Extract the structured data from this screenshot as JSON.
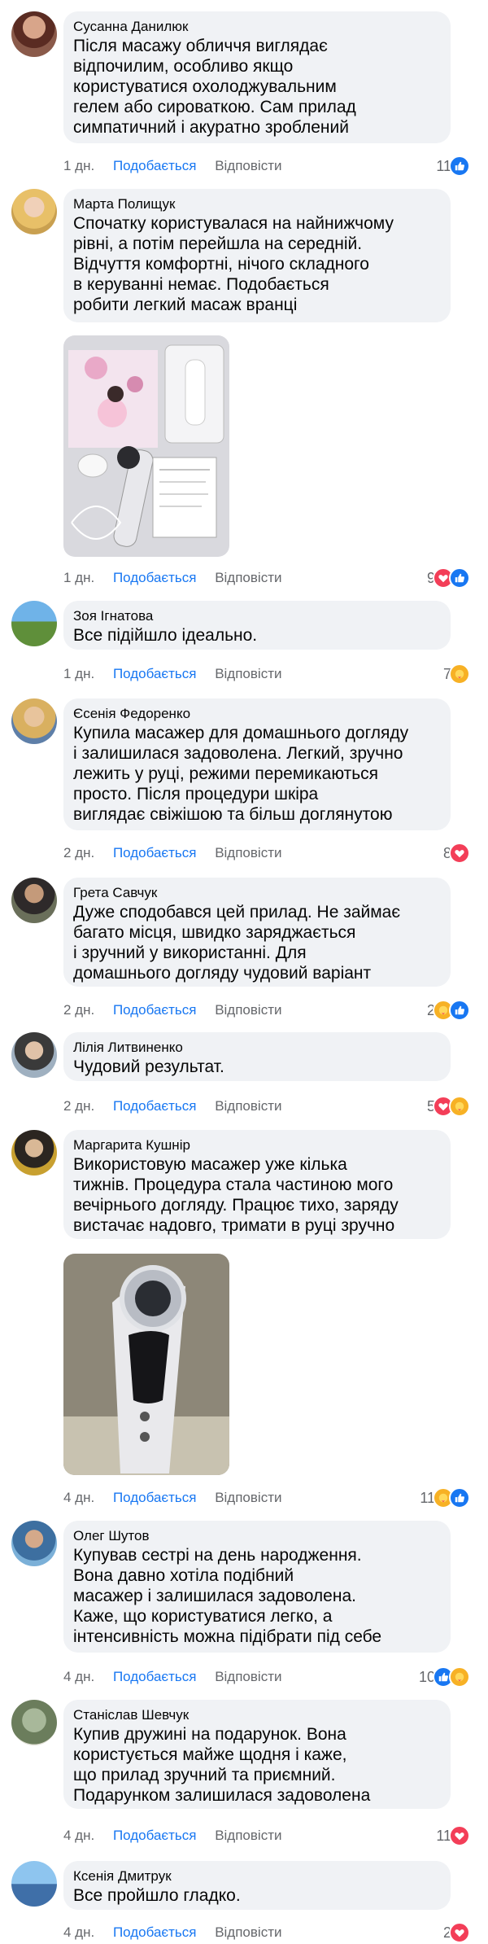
{
  "actions": {
    "like": "Подобається",
    "reply": "Відповісти"
  },
  "colors": {
    "like_blue": "#1877f2",
    "love_red": "#f33e58",
    "care_yellow": "#f7b125",
    "bubble": "#f0f2f5",
    "meta": "#65676b"
  },
  "comments": [
    {
      "author": "Сусанна Данилюк",
      "text": "Після масажу обличчя виглядає\nвідпочилим, особливо якщо\nкористуватися охолоджувальним\nгелем або сироваткою. Сам прилад\nсимпатичний і акуратно зроблений",
      "time": "1 дн.",
      "count": "11",
      "reactions": [
        "like-icon"
      ]
    },
    {
      "author": "Марта Полищук",
      "text": "Спочатку користувалася на найнижчому\nрівні, а потім перейшла на середній.\nВідчуття комфортні, нічого складного\nв керуванні немає. Подобається\nробити легкий масаж вранці",
      "time": "1 дн.",
      "count": "9",
      "reactions": [
        "love-icon",
        "like-icon"
      ],
      "photo": "device-box-photo"
    },
    {
      "author": "Зоя Ігнатова",
      "text": "Все підійшло ідеально.",
      "time": "1 дн.",
      "count": "7",
      "reactions": [
        "care-icon"
      ]
    },
    {
      "author": "Єсенія Федоренко",
      "text": "Купила масажер для домашнього догляду\nі залишилася задоволена. Легкий, зручно\nлежить у руці, режими перемикаються\nпросто. Після процедури шкіра\nвиглядає свіжішою та більш доглянутою",
      "time": "2 дн.",
      "count": "8",
      "reactions": [
        "love-icon"
      ]
    },
    {
      "author": "Грета Савчук",
      "text": "Дуже сподобався цей прилад. Не займає\nбагато місця, швидко заряджається\nі зручний у використанні. Для\nдомашнього догляду чудовий варіант",
      "time": "2 дн.",
      "count": "2",
      "reactions": [
        "care-icon",
        "like-icon"
      ]
    },
    {
      "author": "Лілія Литвиненко",
      "text": "Чудовий результат.",
      "time": "2 дн.",
      "count": "5",
      "reactions": [
        "love-icon",
        "care-icon"
      ]
    },
    {
      "author": "Маргарита Кушнір",
      "text": "Використовую масажер уже кілька\nтижнів. Процедура стала частиною мого\nвечірнього догляду. Працює тихо, заряду\nвистачає надовго, тримати в руці зручно",
      "time": "4 дн.",
      "count": "11",
      "reactions": [
        "care-icon",
        "like-icon"
      ],
      "photo": "device-hand-photo"
    },
    {
      "author": "Олег Шутов",
      "text": "Купував сестрі на день народження.\nВона давно хотіла подібний\nмасажер і залишилася задоволена.\nКаже, що користуватися легко, а\nінтенсивність можна підібрати під себе",
      "time": "4 дн.",
      "count": "10",
      "reactions": [
        "like-icon",
        "care-icon"
      ]
    },
    {
      "author": "Станіслав Шевчук",
      "text": "Купив дружині на подарунок. Вона\nкористується майже щодня і каже,\nщо прилад зручний та приємний.\nПодарунком залишилася задоволена",
      "time": "4 дн.",
      "count": "11",
      "reactions": [
        "love-icon"
      ]
    },
    {
      "author": "Ксенія Дмитрук",
      "text": "Все пройшло гладко.",
      "time": "4 дн.",
      "count": "2",
      "reactions": [
        "love-icon"
      ]
    }
  ]
}
